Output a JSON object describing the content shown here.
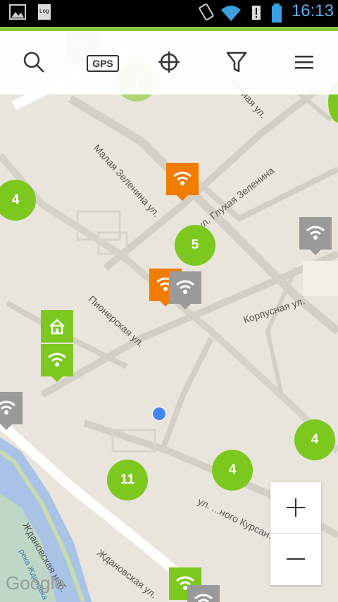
{
  "status_bar": {
    "time": "16:13",
    "icons": [
      "gallery-icon",
      "log-icon",
      "rotate-icon",
      "wifi-icon",
      "alert-icon",
      "battery-icon"
    ]
  },
  "toolbar": {
    "gps_label": "GPS",
    "icons": [
      "search-icon",
      "gps-icon",
      "crosshair-icon",
      "filter-icon",
      "menu-icon"
    ]
  },
  "map": {
    "streets": [
      "Малая Зеленина ул.",
      "ул. Глухая Зеленина",
      "Пионерская ул.",
      "Корпусная ул.",
      "Ждановская наб.",
      "Ждановская ул.",
      "ул. ...ного Курсанта",
      "Речная ул.",
      "река Ждановка"
    ],
    "clusters": [
      "7",
      "4",
      "5",
      "4",
      "4",
      "11"
    ],
    "attribution": "Google"
  },
  "zoom": {
    "in": "+",
    "out": "−"
  },
  "colors": {
    "accent": "#8dc63f",
    "cluster": "#7dc81f",
    "pin_orange": "#f07c00",
    "pin_gray": "#9a9a9a",
    "pin_green": "#7dc81f",
    "my_location": "#4285f4"
  }
}
